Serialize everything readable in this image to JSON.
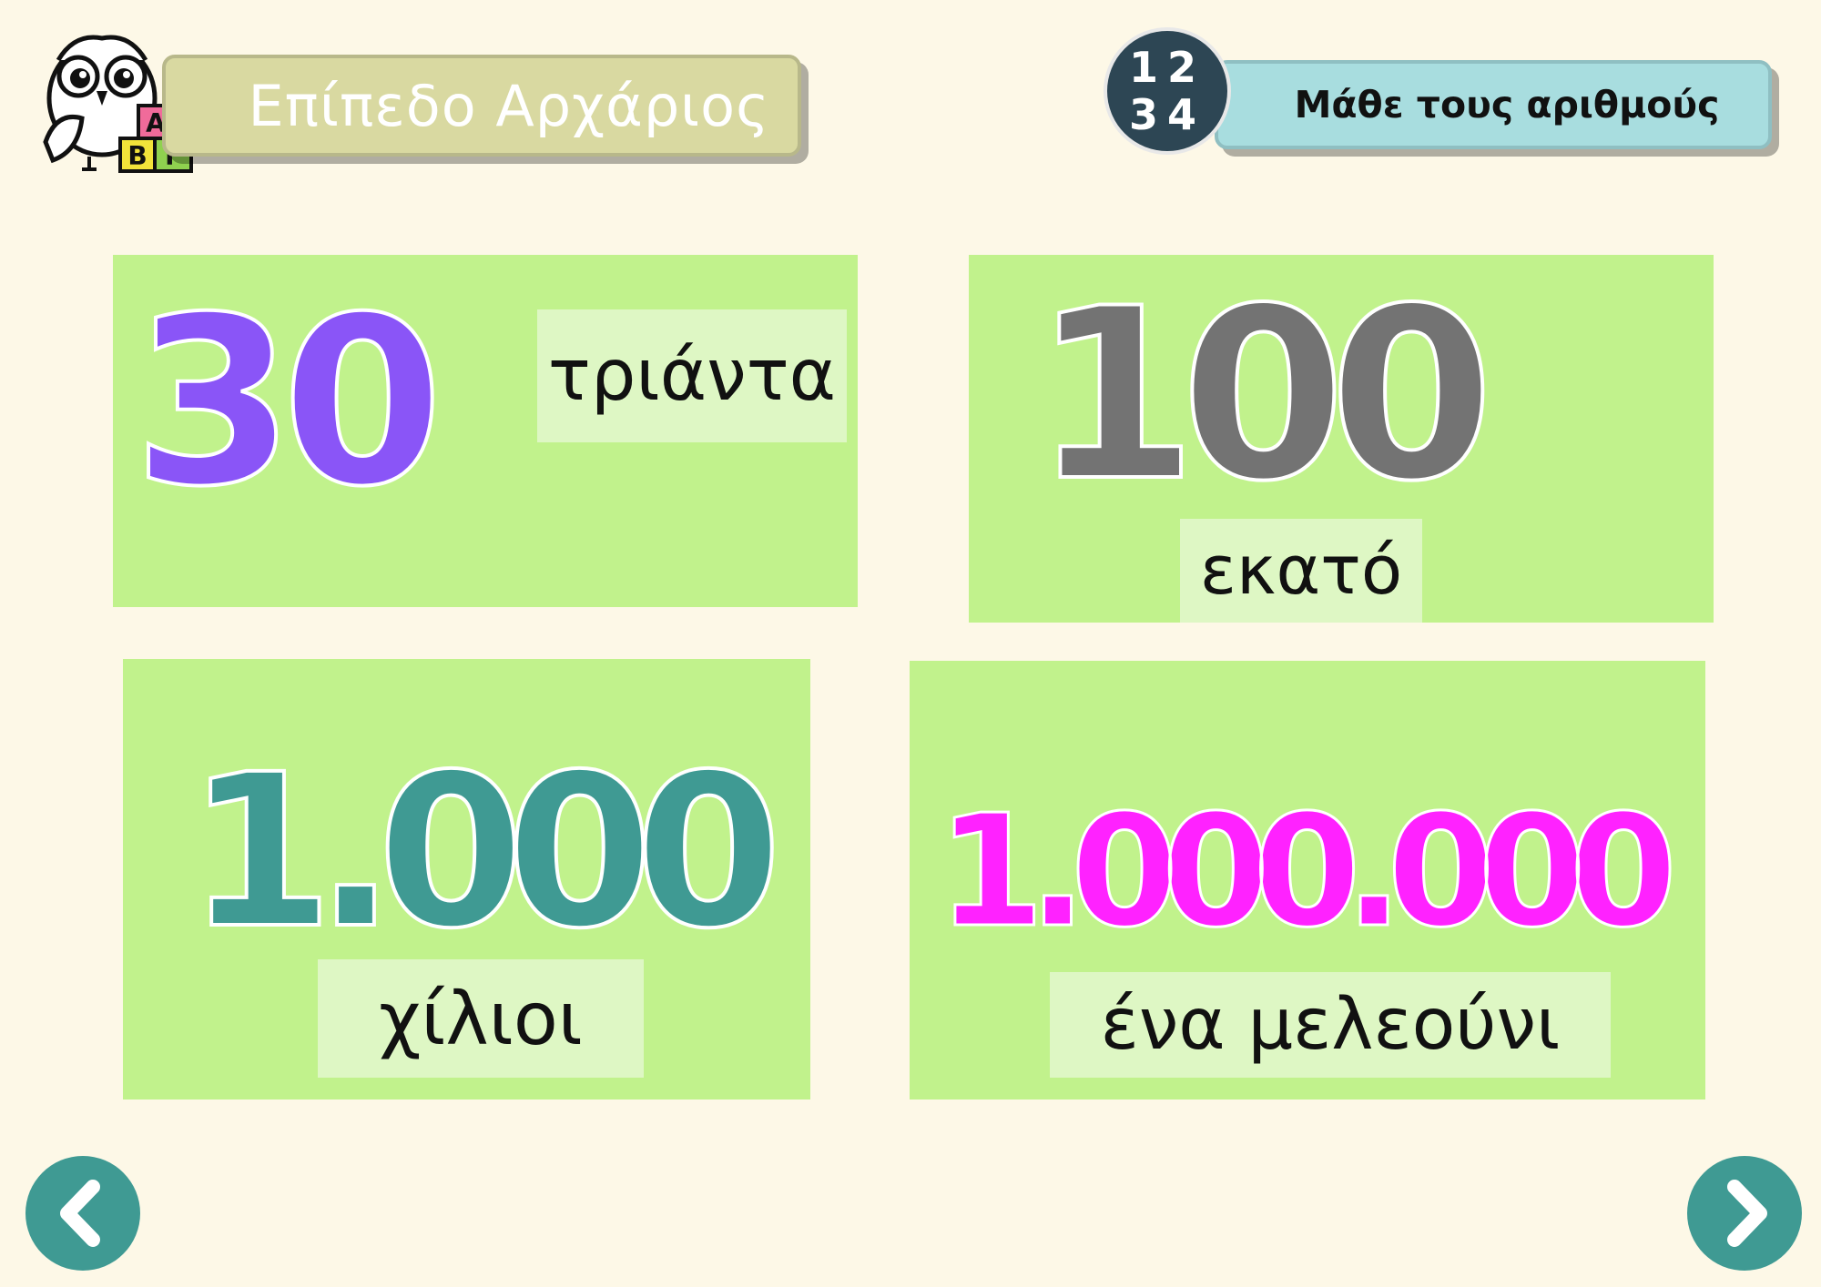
{
  "header": {
    "level_title": "Επίπεδο Αρχάριος",
    "topic_title": "Μάθε τους αριθμούς",
    "numbers_badge": {
      "row1": "12",
      "row2": "34"
    },
    "logo_blocks": [
      "Α",
      "Β",
      "Γ"
    ]
  },
  "cards": [
    {
      "number": "30",
      "word": "τριάντα",
      "number_color": "#8a55f7"
    },
    {
      "number": "100",
      "word": "εκατό",
      "number_color": "#737373"
    },
    {
      "number": "1.000",
      "word": "χίλιοι",
      "number_color": "#3f9a93"
    },
    {
      "number": "1.000.000",
      "word": "ένα μελεούνι",
      "number_color": "#ff22ff"
    }
  ],
  "navigation": {
    "prev_icon": "chevron-left-icon",
    "next_icon": "chevron-right-icon"
  },
  "colors": {
    "background": "#fdf8e7",
    "card": "#c1f28c",
    "word_box": "#def7c4",
    "nav_button": "#3f9a93"
  }
}
